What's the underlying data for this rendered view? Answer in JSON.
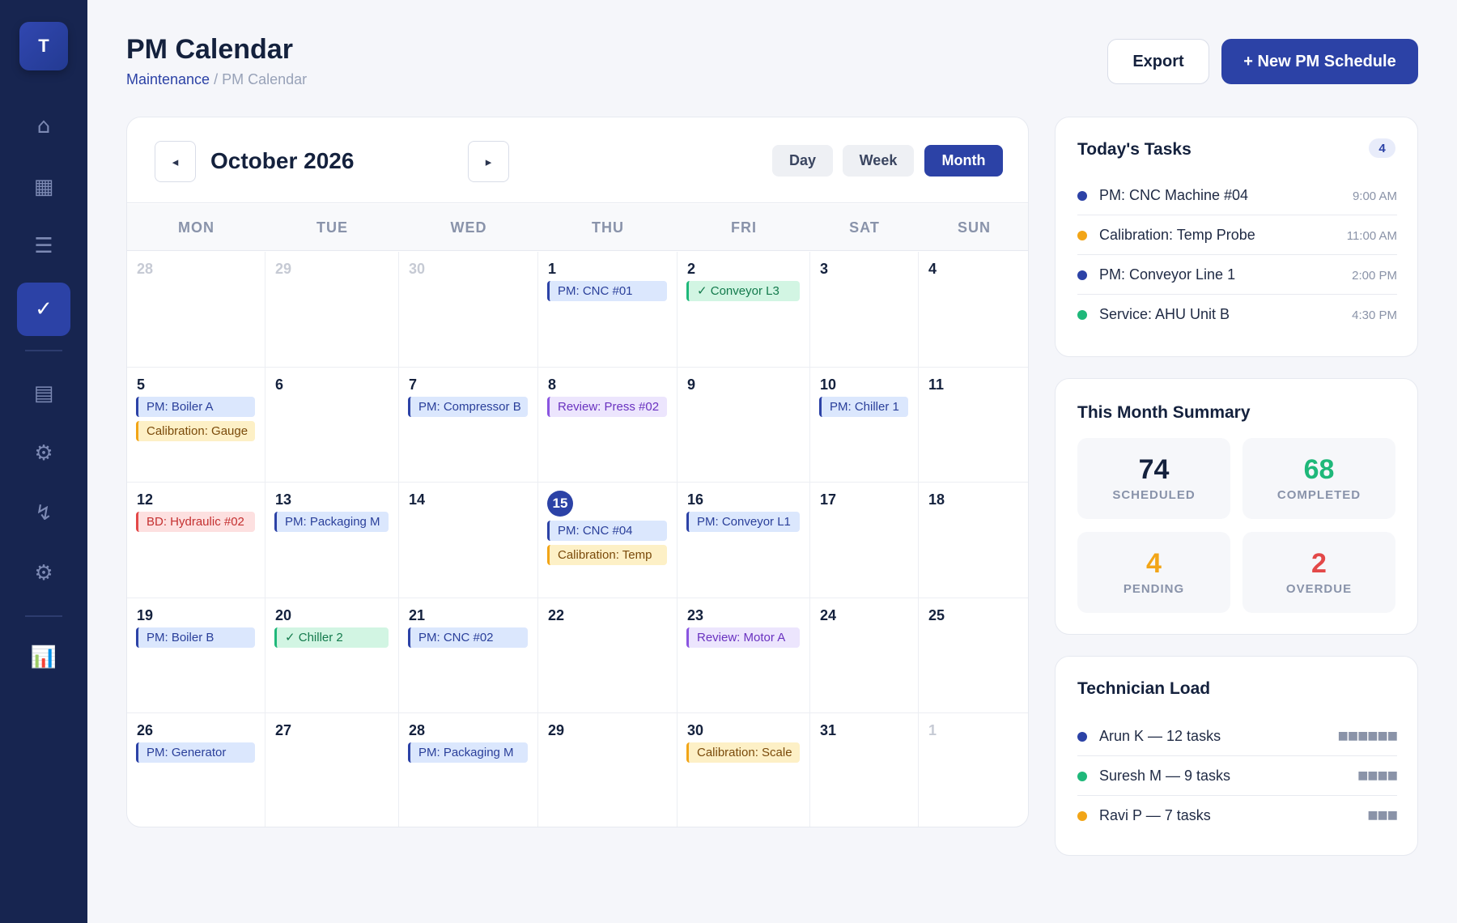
{
  "sidebar": {
    "logo": "T",
    "items": [
      {
        "icon": "home-icon",
        "glyph": "⌂",
        "active": false
      },
      {
        "icon": "grid-icon",
        "glyph": "▦",
        "active": false
      },
      {
        "icon": "list-icon",
        "glyph": "☰",
        "active": false
      },
      {
        "icon": "check-icon",
        "glyph": "✓",
        "active": true
      },
      {
        "icon": "document-icon",
        "glyph": "▤",
        "active": false
      },
      {
        "icon": "gear-outline-icon",
        "glyph": "⚙",
        "active": false
      },
      {
        "icon": "lightning-icon",
        "glyph": "↯",
        "active": false
      },
      {
        "icon": "settings-icon",
        "glyph": "⚙",
        "active": false
      },
      {
        "icon": "bar-chart-icon",
        "glyph": "📊",
        "active": false
      }
    ]
  },
  "header": {
    "title": "PM Calendar",
    "breadcrumb_link": "Maintenance",
    "breadcrumb_rest": "/ PM Calendar",
    "export_label": "Export",
    "new_label": "+ New PM Schedule"
  },
  "calendar": {
    "prev_glyph": "◂",
    "next_glyph": "▸",
    "month_label": "October 2026",
    "views": [
      {
        "label": "Day",
        "active": false
      },
      {
        "label": "Week",
        "active": false
      },
      {
        "label": "Month",
        "active": true
      }
    ],
    "weekdays": [
      "MON",
      "TUE",
      "WED",
      "THU",
      "FRI",
      "SAT",
      "SUN"
    ],
    "weeks": [
      [
        {
          "day": "28",
          "muted": true,
          "events": []
        },
        {
          "day": "29",
          "muted": true,
          "events": []
        },
        {
          "day": "30",
          "muted": true,
          "events": []
        },
        {
          "day": "1",
          "events": [
            {
              "text": "PM: CNC #01",
              "type": "pm"
            }
          ]
        },
        {
          "day": "2",
          "events": [
            {
              "text": "✓ Conveyor L3",
              "type": "done"
            }
          ]
        },
        {
          "day": "3",
          "events": []
        },
        {
          "day": "4",
          "events": []
        }
      ],
      [
        {
          "day": "5",
          "events": [
            {
              "text": "PM: Boiler A",
              "type": "pm"
            },
            {
              "text": "Calibration: Gauge",
              "type": "cal"
            }
          ]
        },
        {
          "day": "6",
          "events": []
        },
        {
          "day": "7",
          "events": [
            {
              "text": "PM: Compressor B",
              "type": "pm"
            }
          ]
        },
        {
          "day": "8",
          "events": [
            {
              "text": "Review: Press #02",
              "type": "review"
            }
          ]
        },
        {
          "day": "9",
          "events": []
        },
        {
          "day": "10",
          "events": [
            {
              "text": "PM: Chiller 1",
              "type": "pm"
            }
          ]
        },
        {
          "day": "11",
          "events": []
        }
      ],
      [
        {
          "day": "12",
          "events": [
            {
              "text": "BD: Hydraulic #02",
              "type": "bd"
            }
          ]
        },
        {
          "day": "13",
          "events": [
            {
              "text": "PM: Packaging M",
              "type": "pm"
            }
          ]
        },
        {
          "day": "14",
          "events": []
        },
        {
          "day": "15",
          "today": true,
          "events": [
            {
              "text": "PM: CNC #04",
              "type": "pm"
            },
            {
              "text": "Calibration: Temp",
              "type": "cal"
            }
          ]
        },
        {
          "day": "16",
          "events": [
            {
              "text": "PM: Conveyor L1",
              "type": "pm"
            }
          ]
        },
        {
          "day": "17",
          "events": []
        },
        {
          "day": "18",
          "events": []
        }
      ],
      [
        {
          "day": "19",
          "events": [
            {
              "text": "PM: Boiler B",
              "type": "pm"
            }
          ]
        },
        {
          "day": "20",
          "events": [
            {
              "text": "✓ Chiller 2",
              "type": "done"
            }
          ]
        },
        {
          "day": "21",
          "events": [
            {
              "text": "PM: CNC #02",
              "type": "pm"
            }
          ]
        },
        {
          "day": "22",
          "events": []
        },
        {
          "day": "23",
          "events": [
            {
              "text": "Review: Motor A",
              "type": "review"
            }
          ]
        },
        {
          "day": "24",
          "events": []
        },
        {
          "day": "25",
          "events": []
        }
      ],
      [
        {
          "day": "26",
          "events": [
            {
              "text": "PM: Generator",
              "type": "pm"
            }
          ]
        },
        {
          "day": "27",
          "events": []
        },
        {
          "day": "28",
          "events": [
            {
              "text": "PM: Packaging M",
              "type": "pm"
            }
          ]
        },
        {
          "day": "29",
          "events": []
        },
        {
          "day": "30",
          "events": [
            {
              "text": "Calibration: Scale",
              "type": "cal"
            }
          ]
        },
        {
          "day": "31",
          "events": []
        },
        {
          "day": "1",
          "muted": true,
          "events": []
        }
      ]
    ]
  },
  "today_tasks": {
    "title": "Today's Tasks",
    "count": "4",
    "items": [
      {
        "name": "PM: CNC Machine #04",
        "time": "9:00 AM",
        "color": "#2c42a6"
      },
      {
        "name": "Calibration: Temp Probe",
        "time": "11:00 AM",
        "color": "#f2a517"
      },
      {
        "name": "PM: Conveyor Line 1",
        "time": "2:00 PM",
        "color": "#2c42a6"
      },
      {
        "name": "Service: AHU Unit B",
        "time": "4:30 PM",
        "color": "#1fb87a"
      }
    ]
  },
  "summary": {
    "title": "This Month Summary",
    "stats": [
      {
        "value": "74",
        "label": "SCHEDULED",
        "color": "#14213d"
      },
      {
        "value": "68",
        "label": "COMPLETED",
        "color": "#1fb87a"
      },
      {
        "value": "4",
        "label": "PENDING",
        "color": "#f2a517"
      },
      {
        "value": "2",
        "label": "OVERDUE",
        "color": "#e34848"
      }
    ]
  },
  "technicians": {
    "title": "Technician Load",
    "items": [
      {
        "name": "Arun K — 12 tasks",
        "bar": "■■■■■■",
        "color": "#2c42a6"
      },
      {
        "name": "Suresh M — 9 tasks",
        "bar": "■■■■",
        "color": "#1fb87a"
      },
      {
        "name": "Ravi P — 7 tasks",
        "bar": "■■■",
        "color": "#f2a517"
      }
    ]
  }
}
